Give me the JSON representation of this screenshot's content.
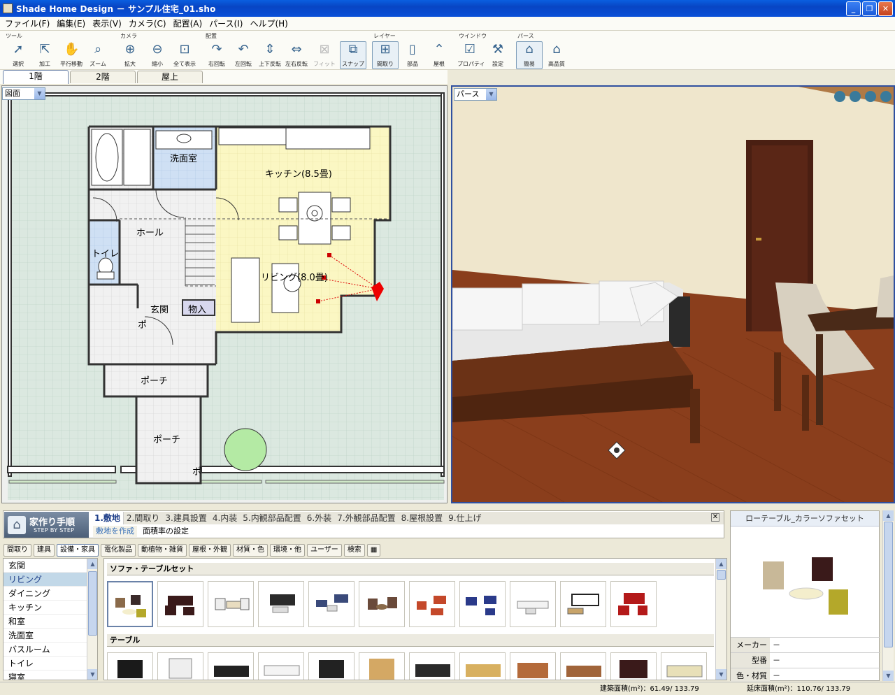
{
  "window": {
    "title": "Shade Home Design － サンプル住宅_01.sho",
    "minimize": "_",
    "maximize": "❐",
    "close": "✕"
  },
  "menu": [
    "ファイル(F)",
    "編集(E)",
    "表示(V)",
    "カメラ(C)",
    "配置(A)",
    "パース(I)",
    "ヘルプ(H)"
  ],
  "toolbar": {
    "groups": {
      "tools": "ツール",
      "camera": "カメラ",
      "place": "配置",
      "layer": "レイヤー",
      "window": "ウインドウ",
      "perspective": "パース"
    },
    "buttons": {
      "select": "選択",
      "edit": "加工",
      "pan": "平行移動",
      "zoom": "ズーム",
      "zoomin": "拡大",
      "zoomout": "縮小",
      "showall": "全て表示",
      "rotr": "右回転",
      "rotl": "左回転",
      "flipv": "上下反転",
      "fliph": "左右反転",
      "fit": "フィット",
      "snap": "スナップ",
      "layout": "間取り",
      "parts": "部品",
      "roof": "屋根",
      "property": "プロパティ",
      "settings": "設定",
      "simple": "簡易",
      "quality": "高品質"
    }
  },
  "floor_tabs": [
    "1階",
    "2階",
    "屋上"
  ],
  "plan": {
    "view_select": "図面",
    "rooms": {
      "bath": "洗面室",
      "kitchen": "キッチン(8.5畳)",
      "hall": "ホール",
      "toilet": "トイレ",
      "living": "リビング(8.0畳)",
      "entrance": "玄関",
      "storage": "物入",
      "porch1": "ポーチ",
      "porch2": "ポーチ",
      "po_short": "ポ",
      "po_short2": "ポ"
    }
  },
  "perspective": {
    "view_select": "パース"
  },
  "step_panel": {
    "logo_title": "家作り手順",
    "logo_sub": "STEP BY STEP",
    "steps": [
      "1.敷地",
      "2.間取り",
      "3.建具設置",
      "4.内装",
      "5.内観部品配置",
      "6.外装",
      "7.外観部品配置",
      "8.屋根設置",
      "9.仕上げ"
    ],
    "substeps": [
      "敷地を作成",
      "面積率の設定"
    ],
    "close": "✕"
  },
  "category_tabs": [
    "間取り",
    "建具",
    "設備・家具",
    "電化製品",
    "動植物・雑貨",
    "屋根・外観",
    "材質・色",
    "環境・他",
    "ユーザー",
    "検索"
  ],
  "room_list": [
    "玄関",
    "リビング",
    "ダイニング",
    "キッチン",
    "和室",
    "洗面室",
    "バスルーム",
    "トイレ",
    "寝室"
  ],
  "gallery": {
    "section1": "ソファ・テーブルセット",
    "section2": "テーブル"
  },
  "preview": {
    "title": "ローテーブル_カラーソファセット",
    "rows": [
      {
        "k": "メーカー",
        "v": "－"
      },
      {
        "k": "型番",
        "v": "－"
      },
      {
        "k": "色・材質",
        "v": "－"
      }
    ]
  },
  "status": {
    "building_area": "建築面積(m²)：61.49/ 133.79",
    "floor_area": "延床面積(m²)：110.76/ 133.79"
  },
  "colors": {
    "titlebar": "#0a50d8",
    "plan_bg": "#dbe8e0",
    "kitchen_floor": "#fbf7c3",
    "bath_floor": "#cfe0f4",
    "floor_wood": "#8a3e1c",
    "wall": "#efe6cc"
  }
}
